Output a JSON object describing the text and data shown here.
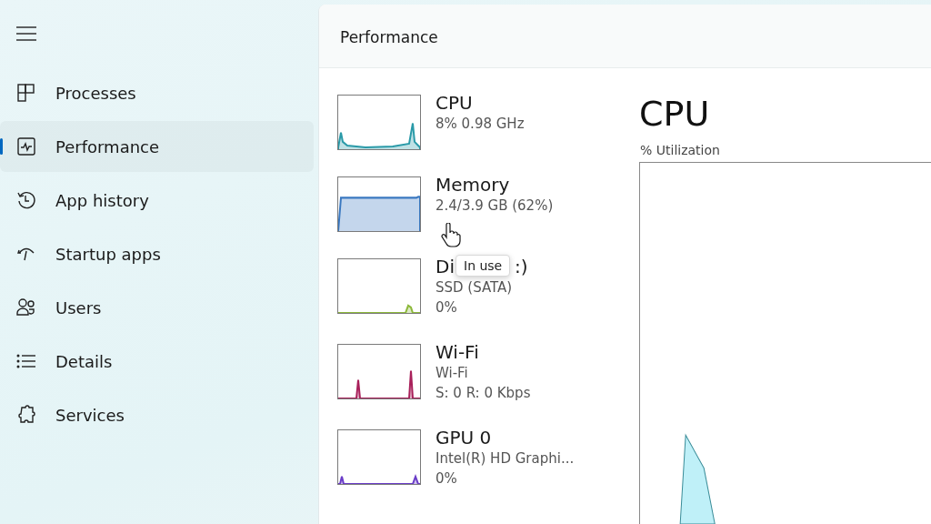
{
  "sidebar": {
    "items": [
      {
        "label": "Processes",
        "selected": false
      },
      {
        "label": "Performance",
        "selected": true
      },
      {
        "label": "App history",
        "selected": false
      },
      {
        "label": "Startup apps",
        "selected": false
      },
      {
        "label": "Users",
        "selected": false
      },
      {
        "label": "Details",
        "selected": false
      },
      {
        "label": "Services",
        "selected": false
      }
    ]
  },
  "page": {
    "title": "Performance"
  },
  "devices": [
    {
      "title": "CPU",
      "lines": [
        "8% 0.98 GHz"
      ],
      "color": "#2a9aa8"
    },
    {
      "title": "Memory",
      "lines": [
        "2.4/3.9 GB (62%)"
      ],
      "color": "#3a78c0"
    },
    {
      "title_start": "Di",
      "title_end": ":)",
      "lines": [
        "SSD (SATA)",
        "0%"
      ],
      "color": "#8cb83a"
    },
    {
      "title": "Wi-Fi",
      "lines": [
        "Wi-Fi",
        "S: 0 R: 0 Kbps"
      ],
      "color": "#a8205a"
    },
    {
      "title": "GPU 0",
      "lines": [
        "Intel(R) HD Graphi...",
        "0%"
      ],
      "color": "#6a3cc8"
    }
  ],
  "tooltip": "In use",
  "detail": {
    "title": "CPU",
    "graph_label": "% Utilization"
  }
}
